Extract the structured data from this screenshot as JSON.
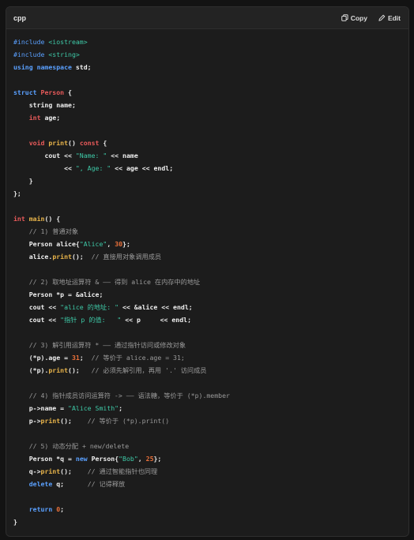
{
  "header": {
    "language": "cpp",
    "copy_label": "Copy",
    "edit_label": "Edit",
    "copy_icon": "copy-icon",
    "edit_icon": "edit-icon"
  },
  "colors": {
    "background": "#131313",
    "panel": "#1c1c1c",
    "keyword": "#5aa0ff",
    "type": "#e85a5a",
    "function": "#e8b44a",
    "string": "#3ec9a7",
    "number": "#e8703a",
    "comment": "#9a9a9a"
  },
  "code": {
    "lines": [
      [
        [
          "pp",
          "#include "
        ],
        [
          "inc",
          "<iostream>"
        ]
      ],
      [
        [
          "pp",
          "#include "
        ],
        [
          "inc",
          "<string>"
        ]
      ],
      [
        [
          "kw",
          "using namespace "
        ],
        [
          "id",
          "std"
        ],
        [
          "op",
          ";"
        ]
      ],
      [],
      [
        [
          "kw",
          "struct "
        ],
        [
          "type",
          "Person"
        ],
        [
          "op",
          " {"
        ]
      ],
      [
        [
          "op",
          "    "
        ],
        [
          "id",
          "string name"
        ],
        [
          "op",
          ";"
        ]
      ],
      [
        [
          "op",
          "    "
        ],
        [
          "type",
          "int"
        ],
        [
          "id",
          " age"
        ],
        [
          "op",
          ";"
        ]
      ],
      [],
      [
        [
          "op",
          "    "
        ],
        [
          "type",
          "void "
        ],
        [
          "fn",
          "print"
        ],
        [
          "op",
          "() "
        ],
        [
          "type",
          "const"
        ],
        [
          "op",
          " {"
        ]
      ],
      [
        [
          "op",
          "        "
        ],
        [
          "id",
          "cout"
        ],
        [
          "op",
          " << "
        ],
        [
          "str",
          "\"Name: \""
        ],
        [
          "op",
          " << "
        ],
        [
          "id",
          "name"
        ]
      ],
      [
        [
          "op",
          "             << "
        ],
        [
          "str",
          "\", Age: \""
        ],
        [
          "op",
          " << "
        ],
        [
          "id",
          "age"
        ],
        [
          "op",
          " << "
        ],
        [
          "id",
          "endl"
        ],
        [
          "op",
          ";"
        ]
      ],
      [
        [
          "op",
          "    }"
        ]
      ],
      [
        [
          "op",
          "};"
        ]
      ],
      [],
      [
        [
          "type",
          "int "
        ],
        [
          "fn",
          "main"
        ],
        [
          "op",
          "() {"
        ]
      ],
      [
        [
          "op",
          "    "
        ],
        [
          "cmt",
          "// 1) 普通对象"
        ]
      ],
      [
        [
          "op",
          "    "
        ],
        [
          "id",
          "Person alice"
        ],
        [
          "op",
          "{"
        ],
        [
          "str",
          "\"Alice\""
        ],
        [
          "op",
          ", "
        ],
        [
          "num",
          "30"
        ],
        [
          "op",
          "};"
        ]
      ],
      [
        [
          "op",
          "    "
        ],
        [
          "id",
          "alice"
        ],
        [
          "op",
          "."
        ],
        [
          "fn",
          "print"
        ],
        [
          "op",
          "();  "
        ],
        [
          "cmt",
          "// 直接用对象调用成员"
        ]
      ],
      [],
      [
        [
          "op",
          "    "
        ],
        [
          "cmt",
          "// 2) 取地址运算符 & —— 得到 alice 在内存中的地址"
        ]
      ],
      [
        [
          "op",
          "    "
        ],
        [
          "id",
          "Person *p"
        ],
        [
          "op",
          " = &"
        ],
        [
          "id",
          "alice"
        ],
        [
          "op",
          ";"
        ]
      ],
      [
        [
          "op",
          "    "
        ],
        [
          "id",
          "cout"
        ],
        [
          "op",
          " << "
        ],
        [
          "str",
          "\"alice 的地址: \""
        ],
        [
          "op",
          " << &"
        ],
        [
          "id",
          "alice"
        ],
        [
          "op",
          " << "
        ],
        [
          "id",
          "endl"
        ],
        [
          "op",
          ";"
        ]
      ],
      [
        [
          "op",
          "    "
        ],
        [
          "id",
          "cout"
        ],
        [
          "op",
          " << "
        ],
        [
          "str",
          "\"指针 p 的值:   \""
        ],
        [
          "op",
          " << "
        ],
        [
          "id",
          "p"
        ],
        [
          "op",
          "     << "
        ],
        [
          "id",
          "endl"
        ],
        [
          "op",
          ";"
        ]
      ],
      [],
      [
        [
          "op",
          "    "
        ],
        [
          "cmt",
          "// 3) 解引用运算符 * —— 通过指针访问或修改对象"
        ]
      ],
      [
        [
          "op",
          "    (*"
        ],
        [
          "id",
          "p"
        ],
        [
          "op",
          ")."
        ],
        [
          "id",
          "age"
        ],
        [
          "op",
          " = "
        ],
        [
          "num",
          "31"
        ],
        [
          "op",
          ";  "
        ],
        [
          "cmt",
          "// 等价于 alice.age = 31;"
        ]
      ],
      [
        [
          "op",
          "    (*"
        ],
        [
          "id",
          "p"
        ],
        [
          "op",
          ")."
        ],
        [
          "fn",
          "print"
        ],
        [
          "op",
          "();   "
        ],
        [
          "cmt",
          "// 必须先解引用，再用 '.' 访问成员"
        ]
      ],
      [],
      [
        [
          "op",
          "    "
        ],
        [
          "cmt",
          "// 4) 指针成员访问运算符 -> —— 语法糖，等价于 (*p).member"
        ]
      ],
      [
        [
          "op",
          "    "
        ],
        [
          "id",
          "p"
        ],
        [
          "op",
          "->"
        ],
        [
          "id",
          "name"
        ],
        [
          "op",
          " = "
        ],
        [
          "str",
          "\"Alice Smith\""
        ],
        [
          "op",
          ";"
        ]
      ],
      [
        [
          "op",
          "    "
        ],
        [
          "id",
          "p"
        ],
        [
          "op",
          "->"
        ],
        [
          "fn",
          "print"
        ],
        [
          "op",
          "();    "
        ],
        [
          "cmt",
          "// 等价于 (*p).print()"
        ]
      ],
      [],
      [
        [
          "op",
          "    "
        ],
        [
          "cmt",
          "// 5) 动态分配 + new/delete"
        ]
      ],
      [
        [
          "op",
          "    "
        ],
        [
          "id",
          "Person *q"
        ],
        [
          "op",
          " = "
        ],
        [
          "kw",
          "new "
        ],
        [
          "id",
          "Person"
        ],
        [
          "op",
          "{"
        ],
        [
          "str",
          "\"Bob\""
        ],
        [
          "op",
          ", "
        ],
        [
          "num",
          "25"
        ],
        [
          "op",
          "};"
        ]
      ],
      [
        [
          "op",
          "    "
        ],
        [
          "id",
          "q"
        ],
        [
          "op",
          "->"
        ],
        [
          "fn",
          "print"
        ],
        [
          "op",
          "();    "
        ],
        [
          "cmt",
          "// 通过智能指针也同理"
        ]
      ],
      [
        [
          "op",
          "    "
        ],
        [
          "kw",
          "delete "
        ],
        [
          "id",
          "q"
        ],
        [
          "op",
          ";      "
        ],
        [
          "cmt",
          "// 记得释放"
        ]
      ],
      [],
      [
        [
          "op",
          "    "
        ],
        [
          "kw",
          "return "
        ],
        [
          "num",
          "0"
        ],
        [
          "op",
          ";"
        ]
      ],
      [
        [
          "op",
          "}"
        ]
      ]
    ]
  }
}
